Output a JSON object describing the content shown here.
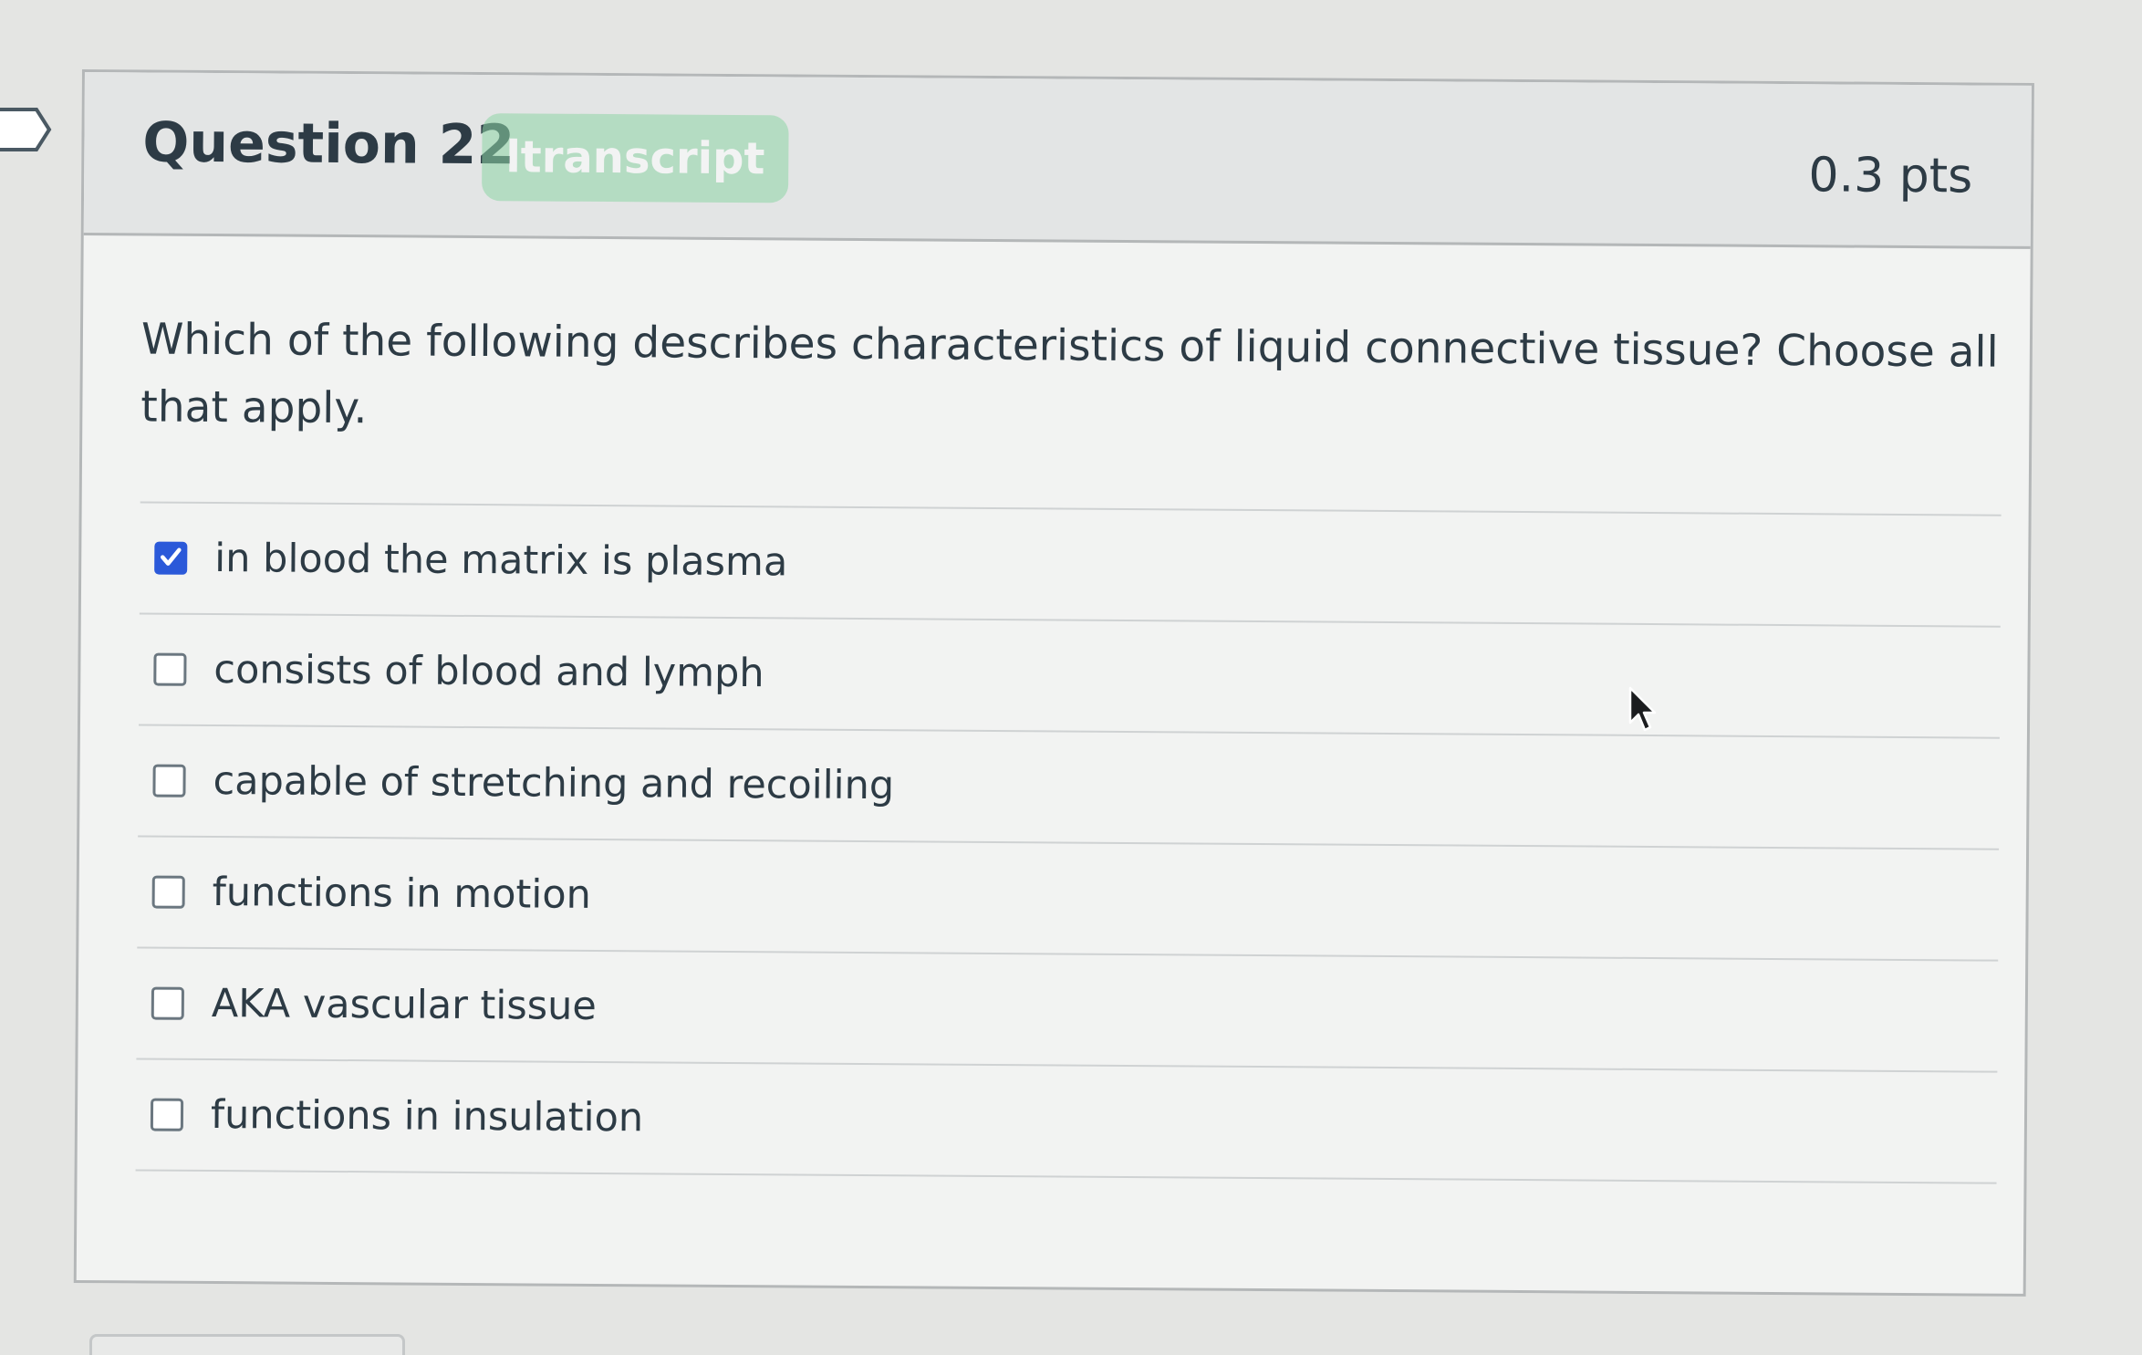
{
  "question": {
    "title": "Question 22",
    "tag": "ltranscript",
    "points": "0.3 pts",
    "text": "Which of the following describes characteristics of liquid connective tissue?  Choose all that apply."
  },
  "answers": [
    {
      "label": "in blood the matrix is plasma",
      "checked": true
    },
    {
      "label": "consists of blood and lymph",
      "checked": false
    },
    {
      "label": "capable of stretching and recoiling",
      "checked": false
    },
    {
      "label": "functions in motion",
      "checked": false
    },
    {
      "label": "AKA vascular tissue",
      "checked": false
    },
    {
      "label": "functions in insulation",
      "checked": false
    }
  ],
  "icons": {
    "bookmark": "bookmark-icon",
    "checkbox_checked": "checkbox-checked-icon",
    "cursor": "mouse-pointer-icon"
  },
  "colors": {
    "checked_accent": "#2b59d9",
    "tag_green": "#8fd6a6",
    "text": "#2d3b45"
  }
}
